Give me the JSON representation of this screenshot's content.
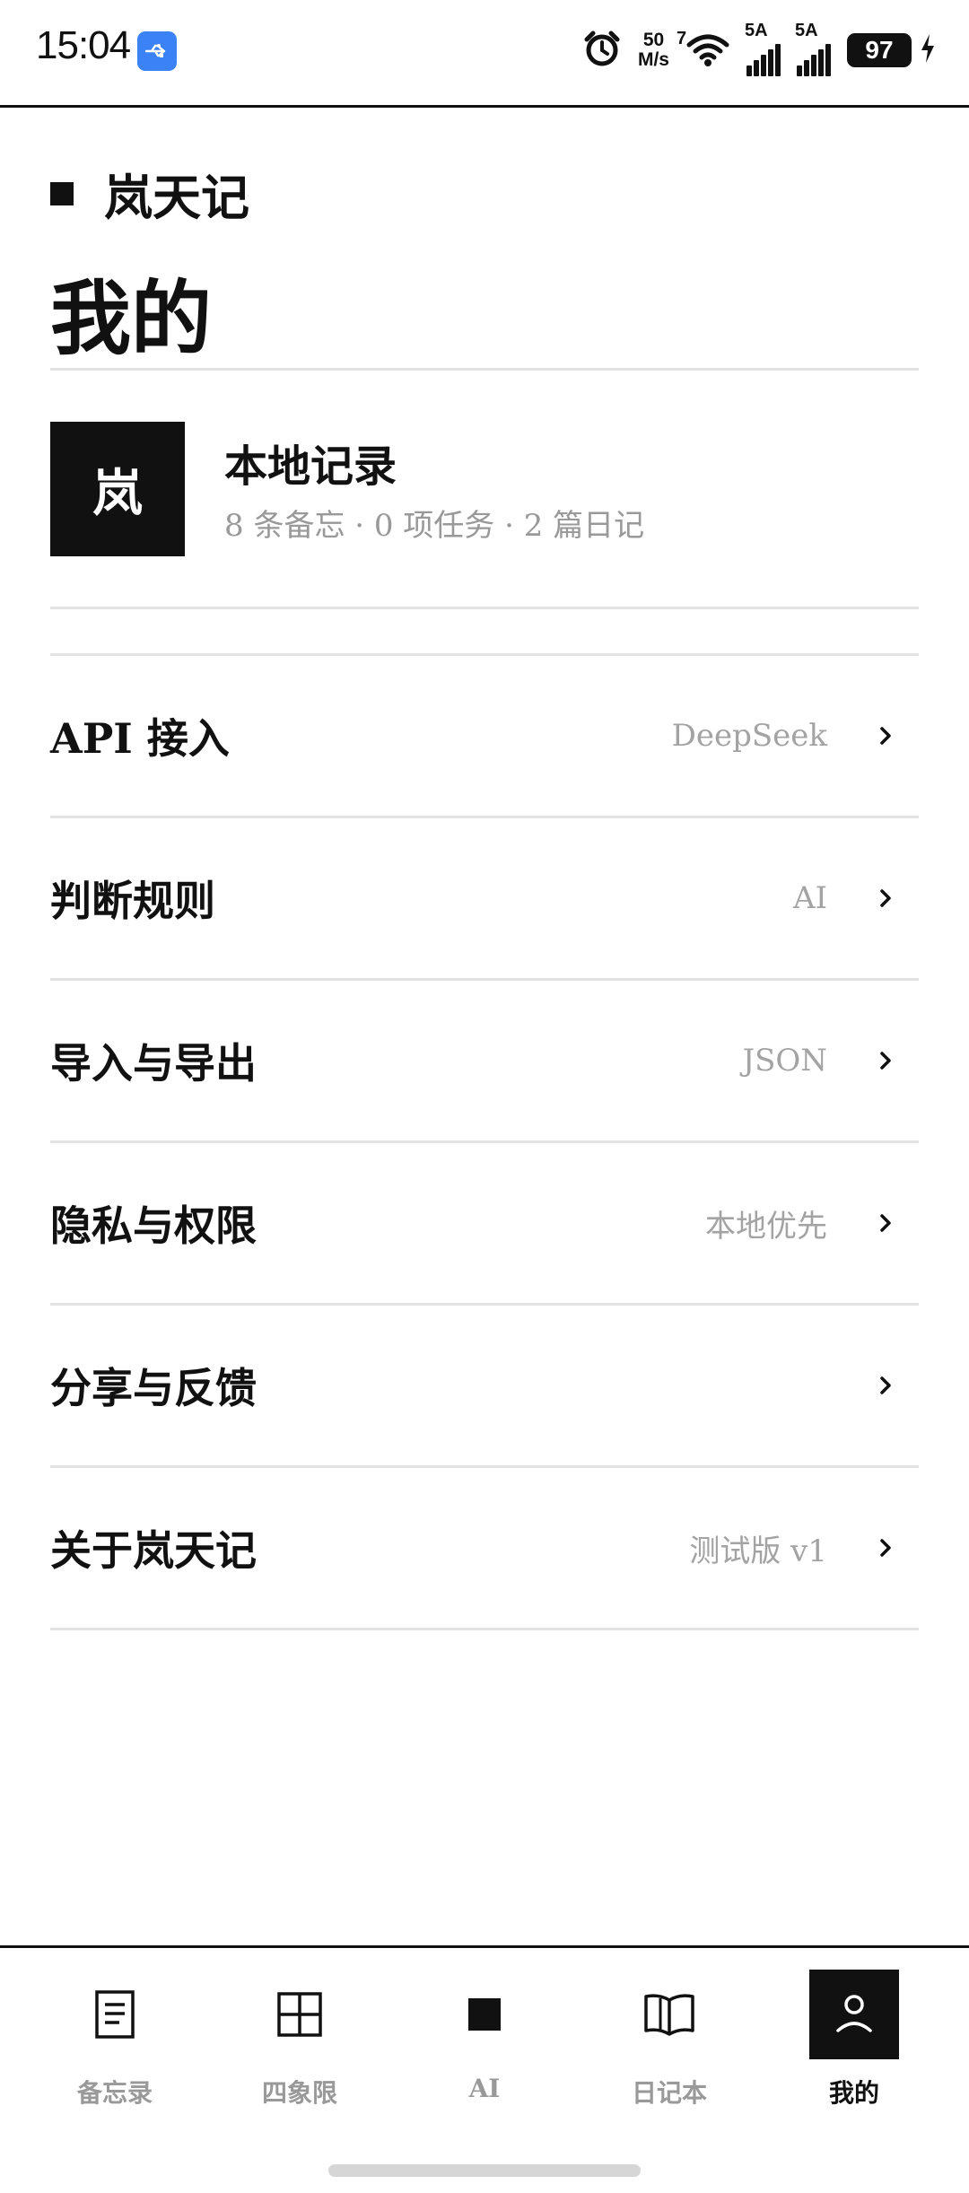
{
  "status_bar": {
    "time": "15:04",
    "network_speed_value": "50",
    "network_speed_unit": "M/s",
    "wifi_label": "7",
    "sim1_label": "5A",
    "sim2_label": "5A",
    "battery_level": "97",
    "icons": [
      "usb-icon",
      "alarm-icon",
      "wifi-icon",
      "signal-icon",
      "signal-icon",
      "battery-icon",
      "charging-icon"
    ]
  },
  "header": {
    "app_name": "岚天记",
    "page_title": "我的"
  },
  "profile": {
    "avatar_char": "岚",
    "name": "本地记录",
    "stats": "8 条备忘 · 0 项任务 · 2 篇日记"
  },
  "menu": {
    "items": [
      {
        "label": "API 接入",
        "value": "DeepSeek"
      },
      {
        "label": "判断规则",
        "value": "AI"
      },
      {
        "label": "导入与导出",
        "value": "JSON"
      },
      {
        "label": "隐私与权限",
        "value": "本地优先"
      },
      {
        "label": "分享与反馈",
        "value": ""
      },
      {
        "label": "关于岚天记",
        "value": "测试版 v1"
      }
    ]
  },
  "bottom_nav": {
    "items": [
      {
        "label": "备忘录",
        "icon": "memo-icon",
        "active": false
      },
      {
        "label": "四象限",
        "icon": "quadrant-icon",
        "active": false
      },
      {
        "label": "AI",
        "icon": "ai-square-icon",
        "active": false
      },
      {
        "label": "日记本",
        "icon": "book-icon",
        "active": false
      },
      {
        "label": "我的",
        "icon": "user-icon",
        "active": true
      }
    ]
  },
  "colors": {
    "accent": "#111111",
    "muted_text": "#999999",
    "divider": "#e3e3e3",
    "usb_badge": "#3b82f6"
  }
}
